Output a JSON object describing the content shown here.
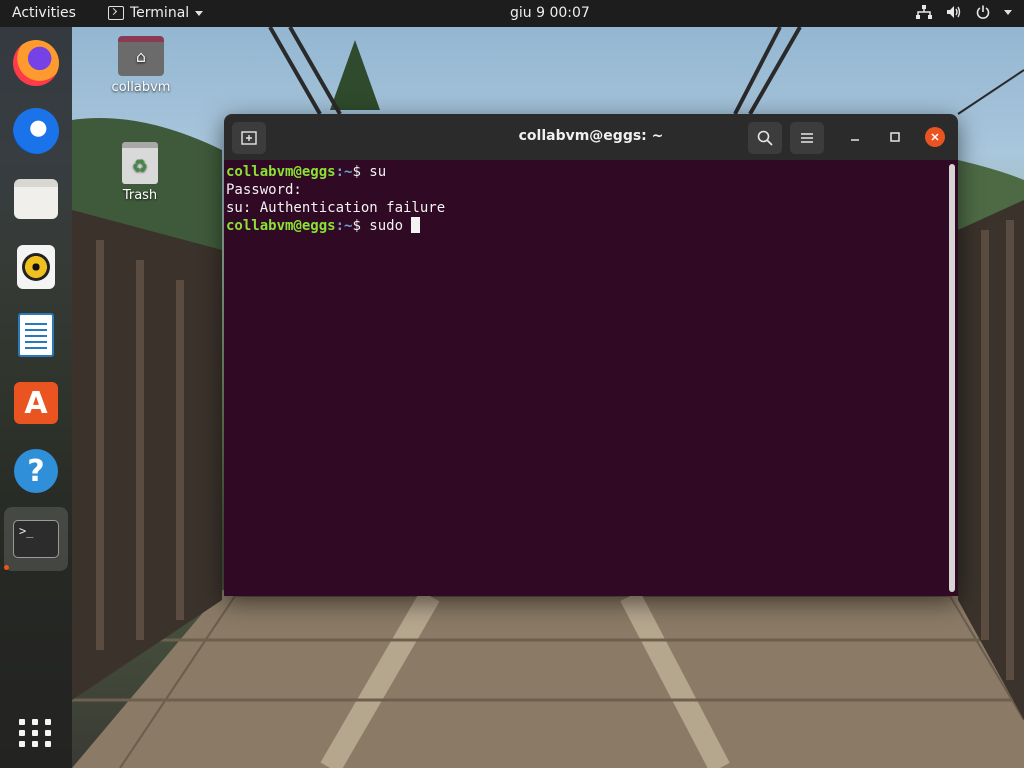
{
  "topbar": {
    "activities": "Activities",
    "app_name": "Terminal",
    "clock": "giu 9  00:07",
    "status_icons": [
      "network-icon",
      "volume-icon",
      "power-icon"
    ]
  },
  "dock": {
    "items": [
      "Firefox",
      "Thunderbird",
      "Files",
      "Rhythmbox",
      "LibreOffice Writer",
      "Ubuntu Software",
      "Help",
      "Terminal",
      "Show Applications"
    ],
    "active_item": "Terminal",
    "accent_color": "#e95420"
  },
  "desktop": {
    "icons": [
      {
        "label": "collabvm",
        "icon": "home-folder-icon"
      },
      {
        "label": "Trash",
        "icon": "trash-icon"
      }
    ]
  },
  "terminal": {
    "title": "collabvm@eggs: ~",
    "background_color": "#300a24",
    "lines": [
      {
        "user": "collabvm@eggs",
        "path": ":~",
        "prompt": "$ ",
        "command": "su"
      },
      {
        "text": "Password:"
      },
      {
        "text": "su: Authentication failure"
      },
      {
        "user": "collabvm@eggs",
        "path": ":~",
        "prompt": "$ ",
        "command": "sudo "
      }
    ]
  }
}
